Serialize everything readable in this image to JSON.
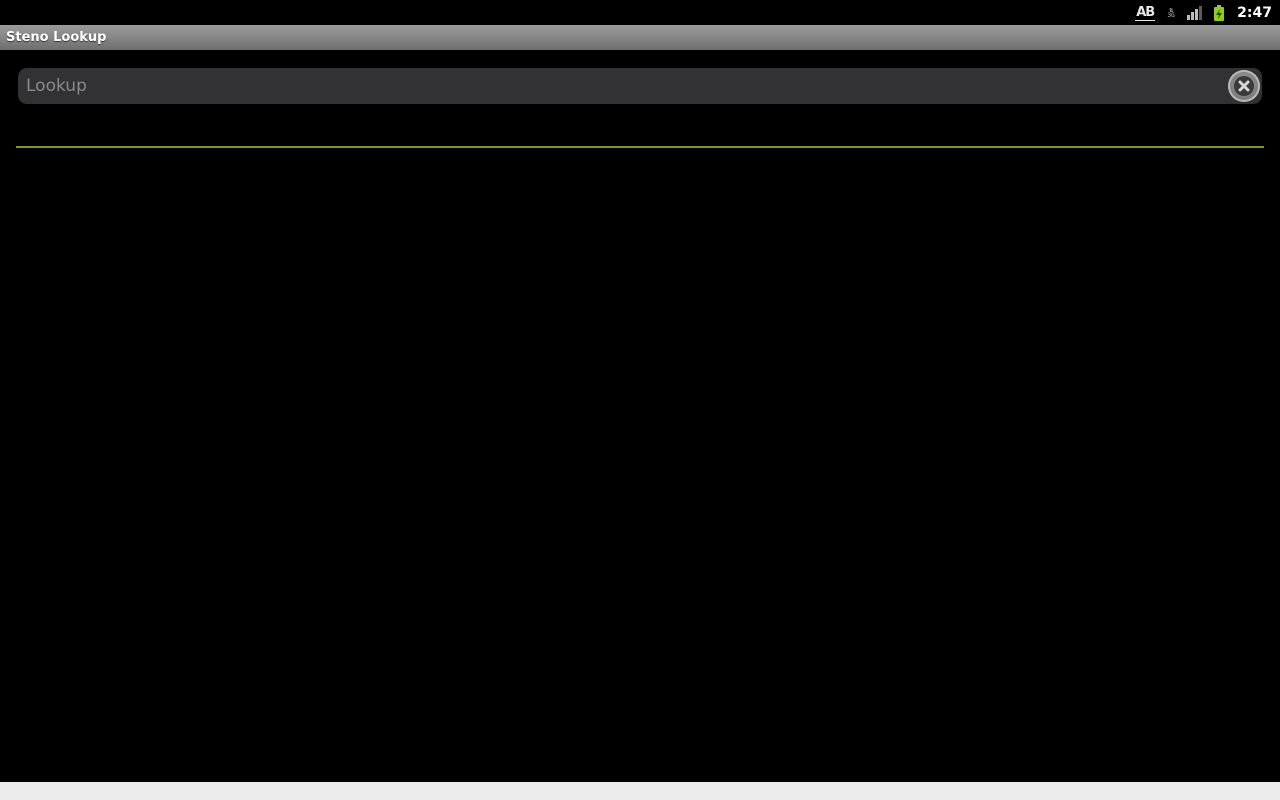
{
  "status_bar": {
    "keyboard_indicator": "AB",
    "network_label": "3G",
    "clock": "2:47",
    "icons": [
      "keyboard-ab-icon",
      "network-3g-icon",
      "signal-strength-icon",
      "battery-charging-icon"
    ],
    "battery_color": "#8ccf1a"
  },
  "app": {
    "title": "Steno Lookup"
  },
  "lookup": {
    "placeholder": "Lookup",
    "value": "",
    "clear_icon": "clear-x-icon"
  },
  "colors": {
    "background": "#000000",
    "title_bar": "#888888",
    "field_background": "#323234",
    "divider_accent": "#7b9a1e",
    "bottom_bar": "#ececec"
  }
}
